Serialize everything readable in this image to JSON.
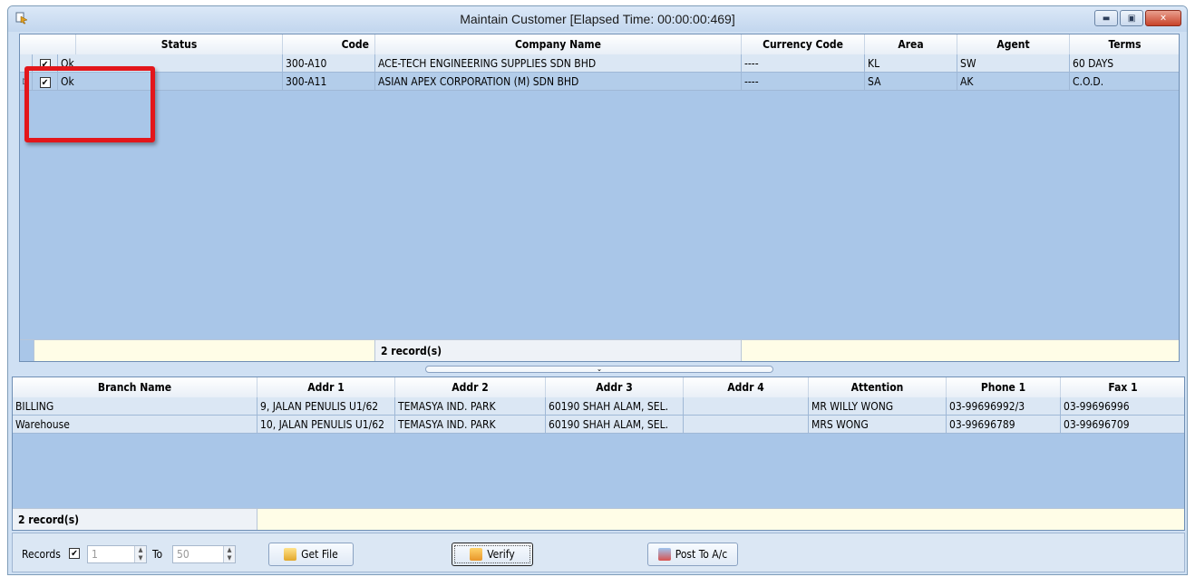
{
  "window": {
    "title": "Maintain Customer [Elapsed Time: 00:00:00:469]",
    "buttons": [
      "minimize",
      "restore",
      "close"
    ]
  },
  "customer_grid": {
    "columns": [
      "Status",
      "Code",
      "Company Name",
      "Currency Code",
      "Area",
      "Agent",
      "Terms"
    ],
    "rows": [
      {
        "checked": true,
        "status": "Ok",
        "code": "300-A10",
        "company": "ACE-TECH ENGINEERING SUPPLIES SDN BHD",
        "currency": "----",
        "area": "KL",
        "agent": "SW",
        "terms": "60 DAYS"
      },
      {
        "checked": true,
        "status": "Ok",
        "code": "300-A11",
        "company": "ASIAN APEX CORPORATION (M) SDN BHD",
        "currency": "----",
        "area": "SA",
        "agent": "AK",
        "terms": "C.O.D."
      }
    ],
    "footer": "2 record(s)"
  },
  "branch_grid": {
    "columns": [
      "Branch Name",
      "Addr 1",
      "Addr 2",
      "Addr 3",
      "Addr 4",
      "Attention",
      "Phone 1",
      "Fax 1"
    ],
    "rows": [
      {
        "branch": "BILLING",
        "addr1": "9, JALAN PENULIS U1/62",
        "addr2": "TEMASYA IND. PARK",
        "addr3": "60190 SHAH ALAM, SEL.",
        "addr4": "",
        "attention": "MR WILLY WONG",
        "phone": "03-99696992/3",
        "fax": "03-99696996"
      },
      {
        "branch": "Warehouse",
        "addr1": "10, JALAN PENULIS U1/62",
        "addr2": "TEMASYA IND. PARK",
        "addr3": "60190 SHAH ALAM, SEL.",
        "addr4": "",
        "attention": "MRS WONG",
        "phone": "03-99696789",
        "fax": "03-99696709"
      }
    ],
    "footer": "2 record(s)"
  },
  "toolbar": {
    "records_label": "Records",
    "records_checked": true,
    "from_value": "1",
    "to_label": "To",
    "to_value": "50",
    "get_file": "Get File",
    "verify": "Verify",
    "post": "Post To A/c"
  }
}
